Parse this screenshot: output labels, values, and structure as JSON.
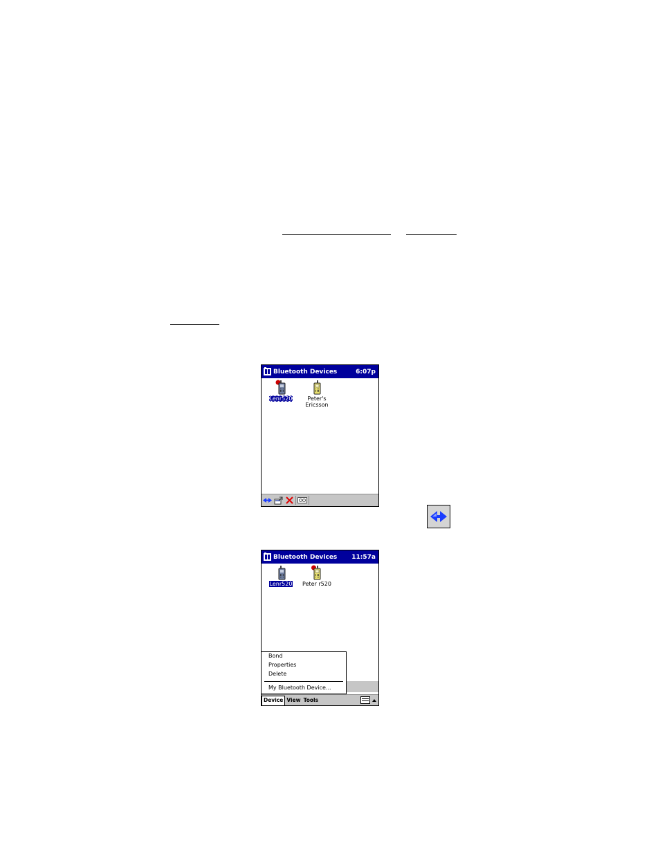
{
  "screen1": {
    "title": "Bluetooth Devices",
    "clock": "6:07p",
    "devices": [
      {
        "name": "Lenr520",
        "selected": true,
        "connected": true,
        "icon": "phone-gray-icon"
      },
      {
        "name": "Peter's Ericsson",
        "selected": false,
        "connected": false,
        "icon": "phone-yellow-icon"
      }
    ],
    "toolbar": [
      "bond-icon",
      "properties-icon",
      "delete-icon",
      "view-icon"
    ]
  },
  "standalone_icon": "bond-icon",
  "screen2": {
    "title": "Bluetooth Devices",
    "clock": "11:57a",
    "devices": [
      {
        "name": "Lenr520",
        "selected": true,
        "connected": false,
        "icon": "phone-gray-icon"
      },
      {
        "name": "Peter r520",
        "selected": false,
        "connected": true,
        "icon": "phone-yellow-icon"
      }
    ],
    "menu": {
      "items": [
        "Bond",
        "Properties",
        "Delete"
      ],
      "extra": "My Bluetooth Device..."
    },
    "menubar": [
      "Device",
      "View",
      "Tools"
    ]
  },
  "colors": {
    "title_bar": "#00009c",
    "toolbar": "#c6c6c6",
    "connected_dot": "#cc0000"
  }
}
